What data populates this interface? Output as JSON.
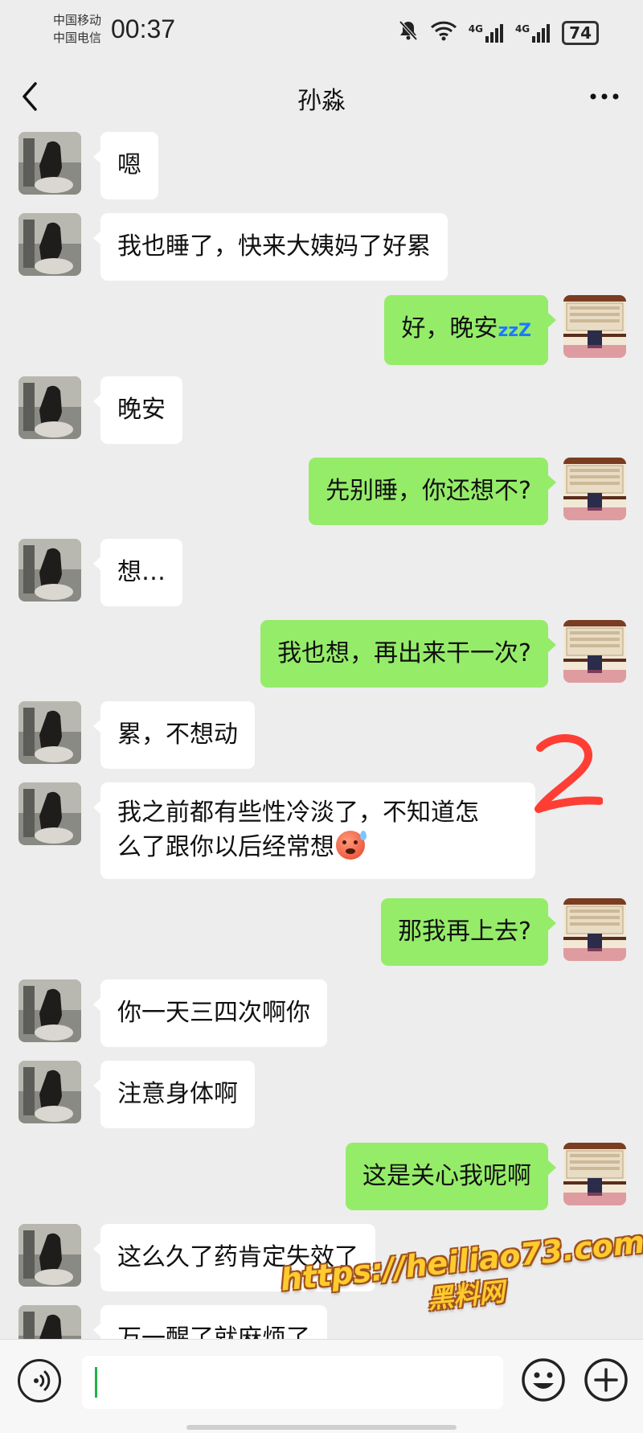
{
  "status_bar": {
    "carrier_1": "中国移动",
    "carrier_2": "中国电信",
    "time": "00:37",
    "net_1": "4G",
    "net_2": "4G",
    "battery": "74"
  },
  "header": {
    "title": "孙淼"
  },
  "messages": [
    {
      "side": "left",
      "text": "嗯"
    },
    {
      "side": "left",
      "text": "我也睡了，快来大姨妈了好累"
    },
    {
      "side": "right",
      "text": "好，晚安",
      "suffix": "zzZ"
    },
    {
      "side": "left",
      "text": "晚安"
    },
    {
      "side": "right",
      "text": "先别睡，你还想不?"
    },
    {
      "side": "left",
      "text": "想…"
    },
    {
      "side": "right",
      "text": "我也想，再出来干一次?"
    },
    {
      "side": "left",
      "text": "累，不想动"
    },
    {
      "side": "left",
      "text": "我之前都有些性冷淡了，不知道怎\n么了跟你以后经常想"
    },
    {
      "side": "right",
      "text": "那我再上去?"
    },
    {
      "side": "left",
      "text": "你一天三四次啊你"
    },
    {
      "side": "left",
      "text": "注意身体啊"
    },
    {
      "side": "right",
      "text": "这是关心我呢啊"
    },
    {
      "side": "left",
      "text": "这么久了药肯定失效了"
    },
    {
      "side": "left",
      "text": "万一醒了就麻烦了"
    }
  ],
  "watermark": {
    "url": "https://heiliao73.com",
    "name": "黑料网"
  },
  "colors": {
    "background": "#ededed",
    "bubble_right": "#95ec69",
    "bubble_left": "#ffffff",
    "caret": "#22b14c"
  }
}
